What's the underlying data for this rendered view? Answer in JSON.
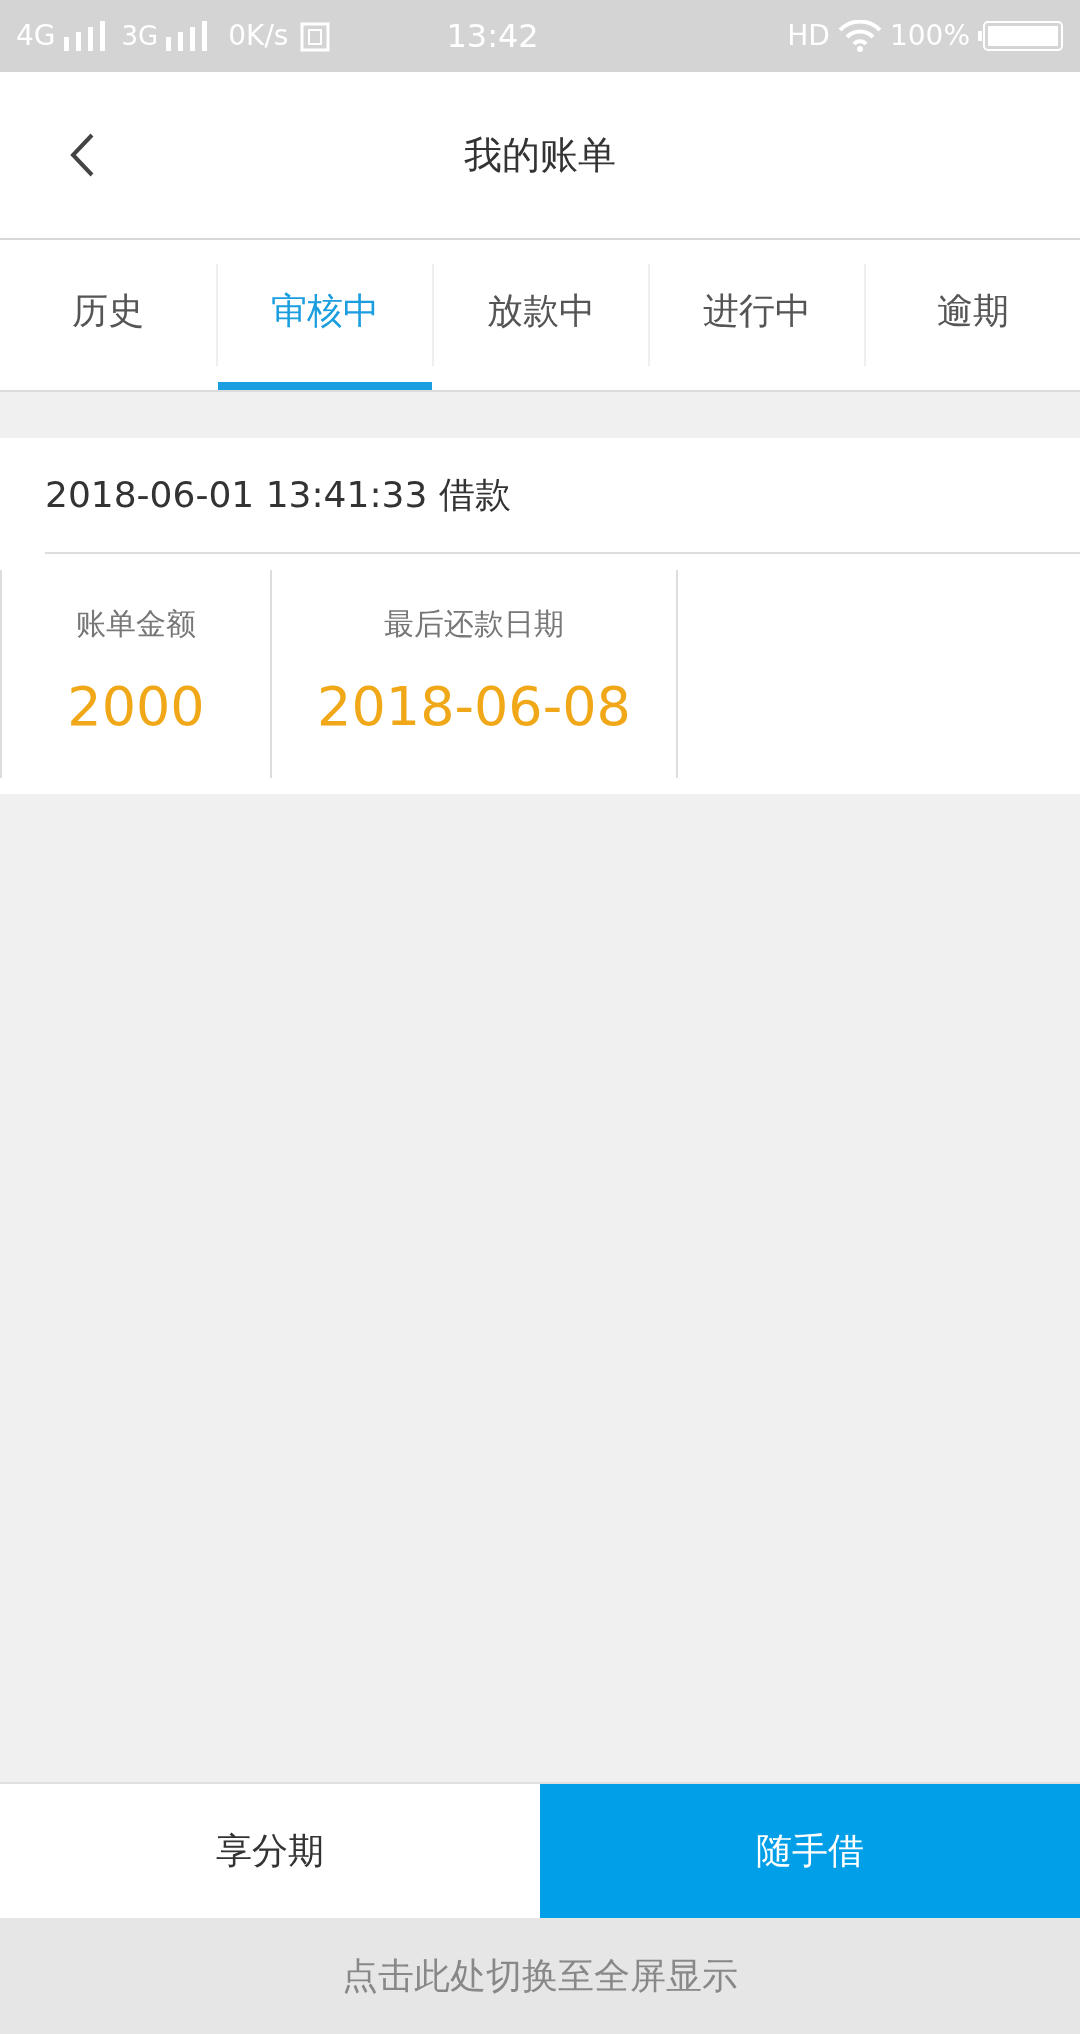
{
  "status_bar": {
    "network_1": "4G",
    "network_2": "3G",
    "speed": "0K/s",
    "time": "13:42",
    "hd": "HD",
    "battery": "100%"
  },
  "header": {
    "title": "我的账单"
  },
  "tabs": [
    {
      "label": "历史",
      "selected": false
    },
    {
      "label": "审核中",
      "selected": true
    },
    {
      "label": "放款中",
      "selected": false
    },
    {
      "label": "进行中",
      "selected": false
    },
    {
      "label": "逾期",
      "selected": false
    }
  ],
  "bills": [
    {
      "title": "2018-06-01 13:41:33 借款",
      "fields": [
        {
          "label": "账单金额",
          "value": "2000"
        },
        {
          "label": "最后还款日期",
          "value": "2018-06-08"
        }
      ]
    }
  ],
  "bottom_buttons": [
    {
      "label": "享分期",
      "selected": false
    },
    {
      "label": "随手借",
      "selected": true
    }
  ],
  "fullscreen_hint": "点击此处切换至全屏显示"
}
